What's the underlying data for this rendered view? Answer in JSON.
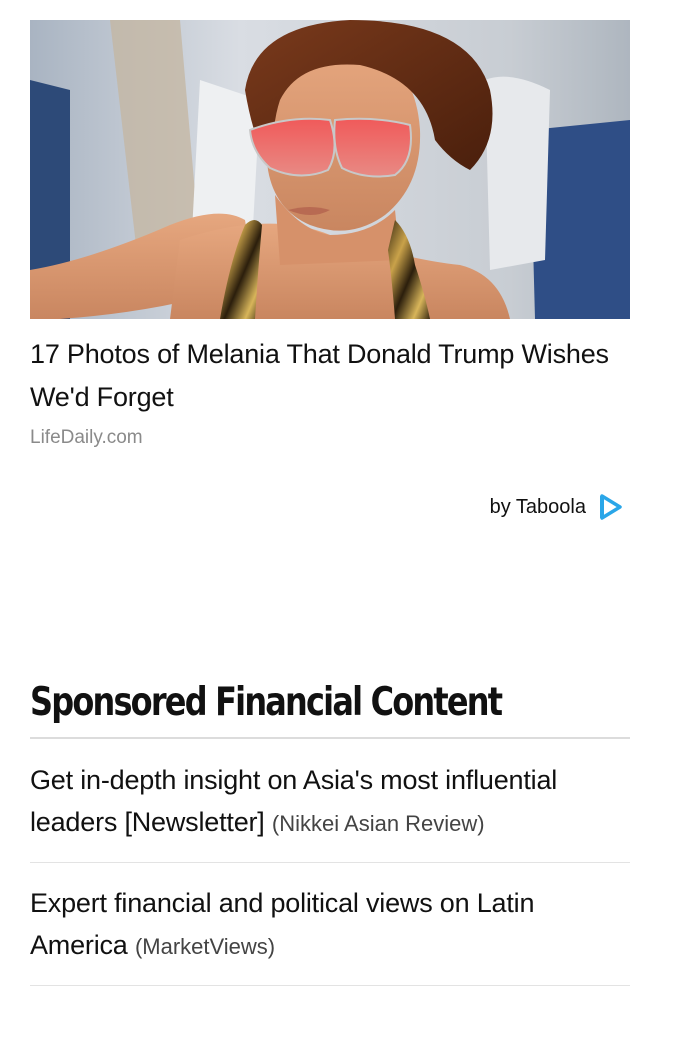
{
  "promo": {
    "image_alt": "Woman with short brown hair wearing red sunglasses and a metallic halter top, seated in an airplane cabin",
    "headline": "17 Photos of Melania That Donald Trump Wishes We'd Forget",
    "source": "LifeDaily.com"
  },
  "taboola": {
    "label": "by Taboola",
    "icon": "taboola-play-icon",
    "icon_color": "#2aa6e8"
  },
  "sponsored": {
    "title": "Sponsored Financial Content",
    "items": [
      {
        "text": "Get in-depth insight on Asia's most influential leaders [Newsletter]",
        "source": "(Nikkei Asian Review)"
      },
      {
        "text": "Expert financial and political views on Latin America",
        "source": "(MarketViews)"
      }
    ]
  }
}
